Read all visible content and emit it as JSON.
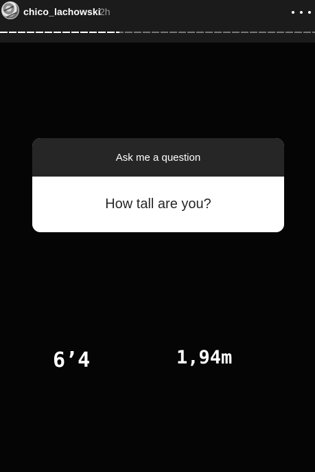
{
  "story": {
    "username": "chico_lachowski",
    "time": "2h",
    "progress_fraction": 0.38,
    "question_box": {
      "prompt": "Ask me a question",
      "question": "How tall are you?"
    },
    "answers": {
      "height_ft": "6’4",
      "height_m": "1,94m"
    }
  },
  "icons": {
    "avatar": "avatar-image",
    "more": "more-options-icon"
  },
  "colors": {
    "background": "#000000",
    "header": "#1b1b1b",
    "card_header": "#262626",
    "card_body": "#ffffff",
    "text_light": "#ffffff",
    "text_muted": "#9b9b9b"
  }
}
